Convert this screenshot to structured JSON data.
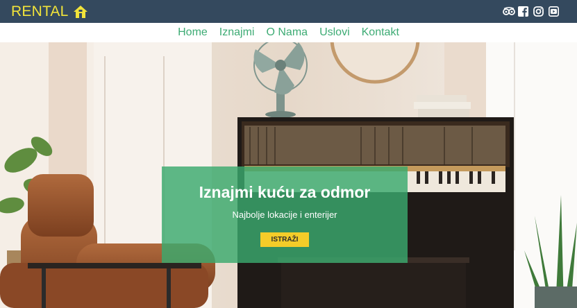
{
  "brand": {
    "name": "RENTAL",
    "logo_icon": "house-icon",
    "accent": "#f1e33a",
    "bar_color": "#34495e"
  },
  "social": [
    {
      "icon": "tripadvisor-icon"
    },
    {
      "icon": "facebook-icon"
    },
    {
      "icon": "instagram-icon"
    },
    {
      "icon": "youtube-icon"
    }
  ],
  "nav": {
    "items": [
      {
        "label": "Home"
      },
      {
        "label": "Iznajmi"
      },
      {
        "label": "O Nama"
      },
      {
        "label": "Uslovi"
      },
      {
        "label": "Kontakt"
      }
    ],
    "color": "#3dab74"
  },
  "hero": {
    "title": "Iznajmi kuću za odmor",
    "subtitle": "Najbolje lokacije i enterijer",
    "button_label": "ISTRAŽI",
    "overlay_color": "#3aaa6e",
    "button_color": "#f4cc29"
  }
}
